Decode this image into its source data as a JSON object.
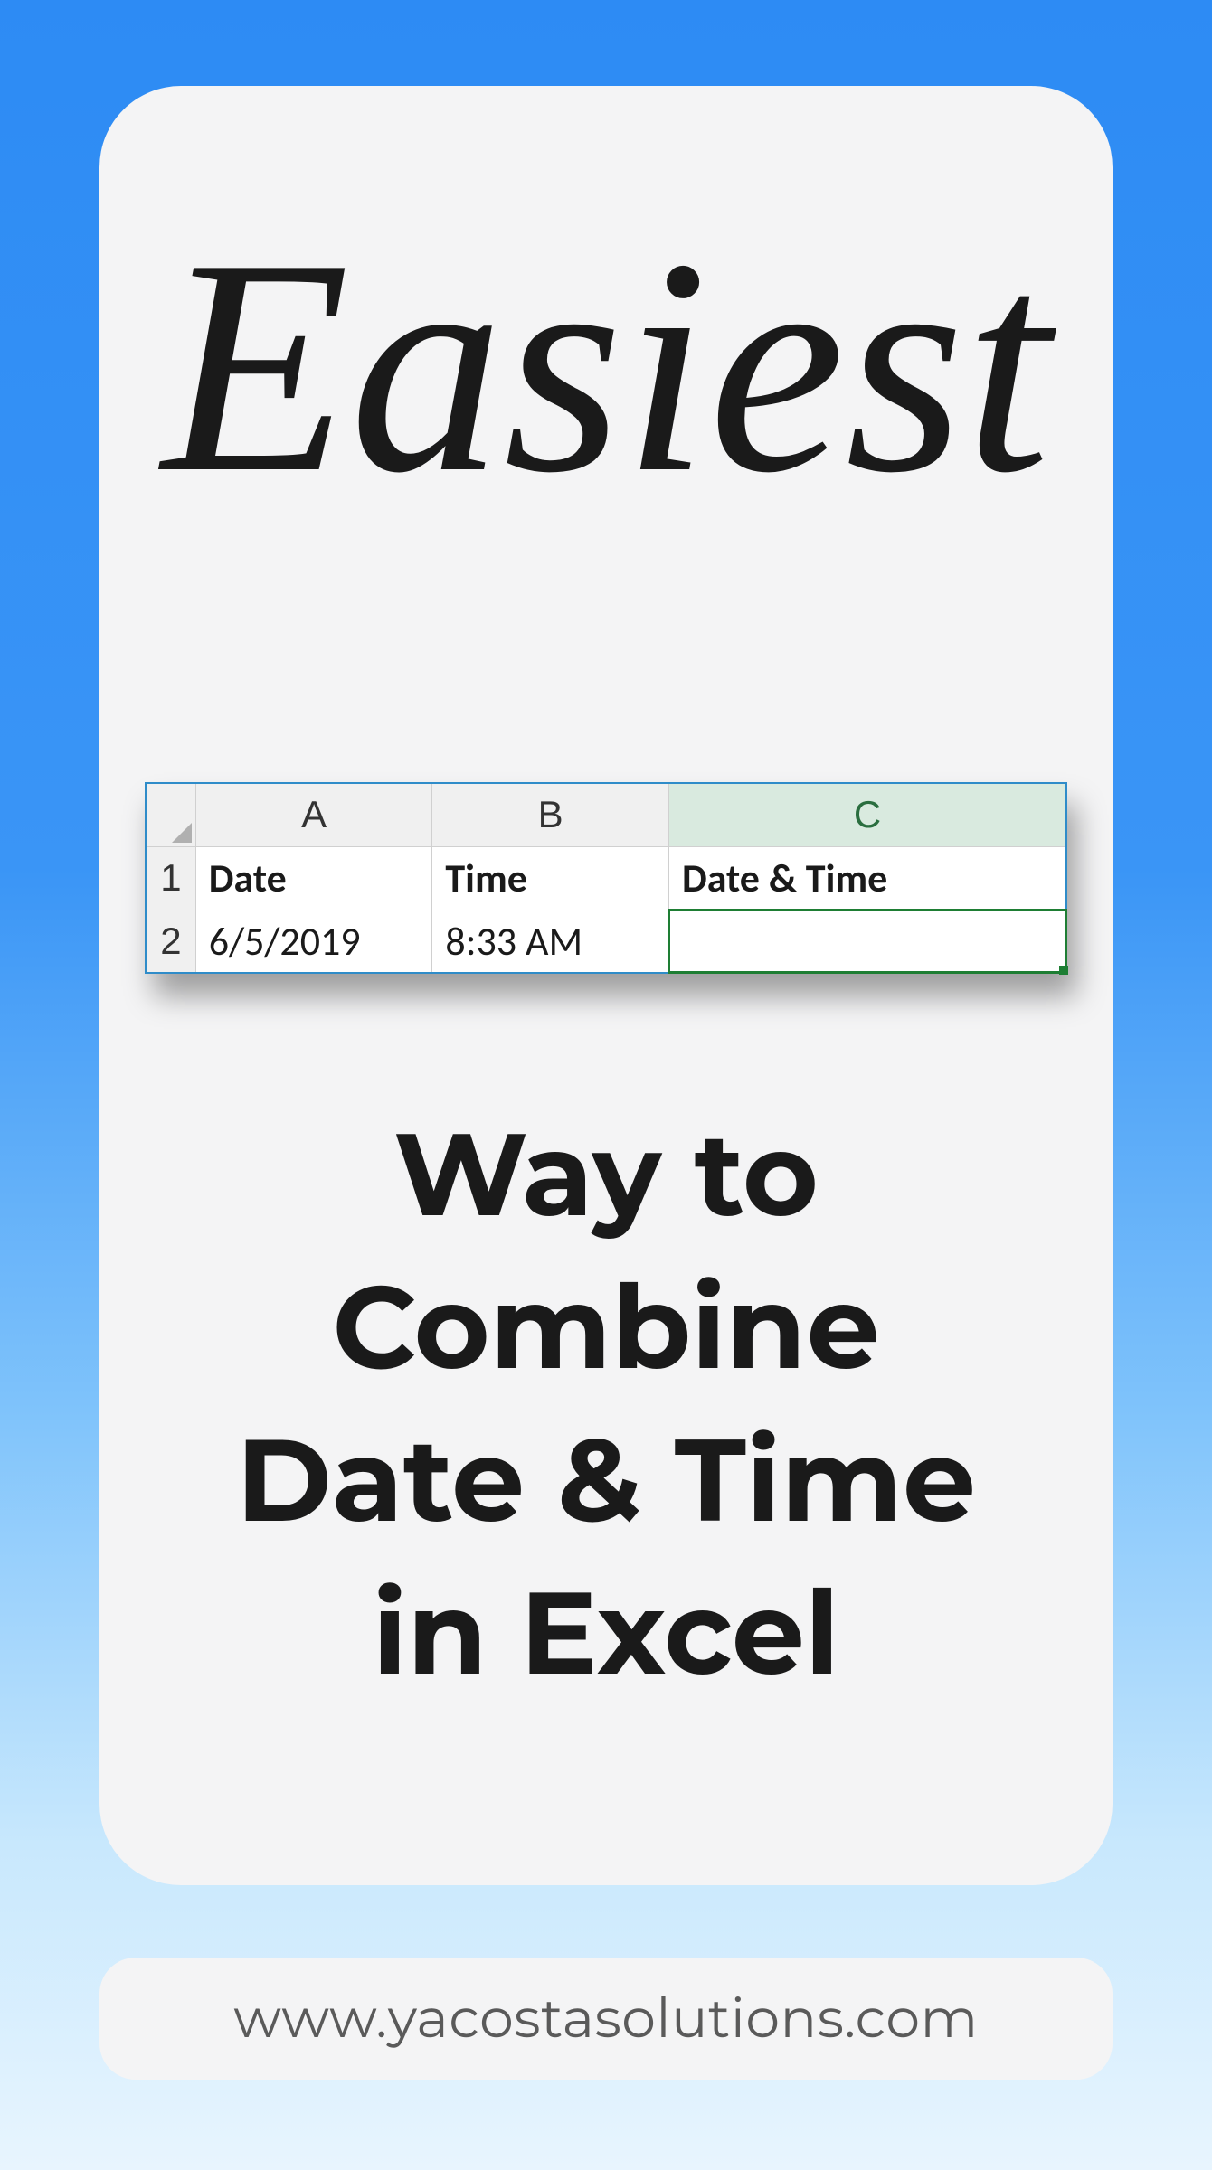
{
  "heading": {
    "script_word": "Easiest",
    "subtitle": "Way to\nCombine\nDate & Time\nin Excel"
  },
  "spreadsheet": {
    "columns": [
      "A",
      "B",
      "C"
    ],
    "selected_column_index": 2,
    "rows": [
      {
        "num": "1",
        "cells": [
          "Date",
          "Time",
          "Date & Time"
        ],
        "bold": true
      },
      {
        "num": "2",
        "cells": [
          "6/5/2019",
          "8:33 AM",
          ""
        ],
        "bold": false,
        "selected_cell_index": 2
      }
    ]
  },
  "footer": {
    "url": "www.yacostasolutions.com"
  }
}
